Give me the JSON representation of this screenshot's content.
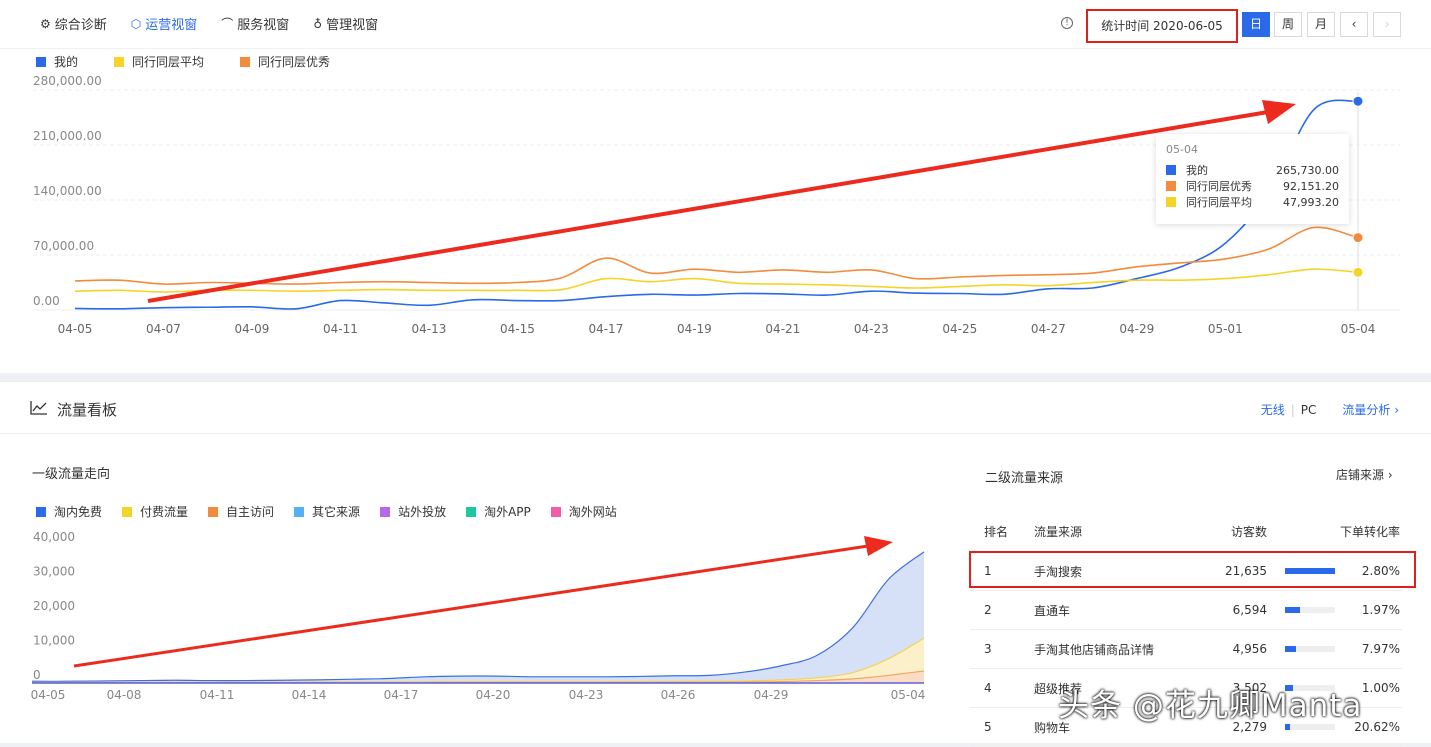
{
  "tabs": [
    {
      "label": "综合诊断",
      "icon": "diagnosis-icon",
      "active": false
    },
    {
      "label": "运营视窗",
      "icon": "operation-icon",
      "active": true
    },
    {
      "label": "服务视窗",
      "icon": "headset-icon",
      "active": false
    },
    {
      "label": "管理视窗",
      "icon": "management-icon",
      "active": false
    }
  ],
  "toolbar": {
    "stat_time": "统计时间 2020-06-05",
    "period_day": "日",
    "period_week": "周",
    "period_month": "月",
    "prev": "‹",
    "next": "›"
  },
  "top_chart": {
    "legend": [
      "我的",
      "同行同层平均",
      "同行同层优秀"
    ],
    "chart_data": {
      "type": "line",
      "x": [
        "04-05",
        "04-06",
        "04-07",
        "04-08",
        "04-09",
        "04-10",
        "04-11",
        "04-12",
        "04-13",
        "04-14",
        "04-15",
        "04-16",
        "04-17",
        "04-18",
        "04-19",
        "04-20",
        "04-21",
        "04-22",
        "04-23",
        "04-24",
        "04-25",
        "04-26",
        "04-27",
        "04-28",
        "04-29",
        "04-30",
        "05-01",
        "05-02",
        "05-03",
        "05-04"
      ],
      "x_tick_labels": [
        "04-05",
        "04-07",
        "04-09",
        "04-11",
        "04-13",
        "04-15",
        "04-17",
        "04-19",
        "04-21",
        "04-23",
        "04-25",
        "04-27",
        "04-29",
        "05-01",
        "05-04"
      ],
      "y_tick_labels": [
        "0.00",
        "70,000.00",
        "140,000.00",
        "210,000.00",
        "280,000.00"
      ],
      "ylim": [
        0,
        280000
      ],
      "series": [
        {
          "name": "我的",
          "color": "#2a6ae9",
          "values": [
            2000,
            1500,
            3000,
            3500,
            4000,
            1500,
            12000,
            9000,
            6000,
            13000,
            12000,
            12000,
            17000,
            20000,
            19000,
            21000,
            20500,
            19000,
            24000,
            21500,
            21000,
            20000,
            27000,
            28000,
            40000,
            55000,
            85000,
            150000,
            255000,
            265730
          ]
        },
        {
          "name": "同行同层平均",
          "color": "#f5d327",
          "values": [
            24000,
            25000,
            23000,
            25000,
            25000,
            24000,
            25000,
            26000,
            25000,
            25000,
            25000,
            26000,
            40000,
            36000,
            40000,
            34000,
            33000,
            32000,
            30000,
            28000,
            30000,
            32000,
            31000,
            35000,
            38000,
            38000,
            40000,
            45000,
            52000,
            47993.2
          ]
        },
        {
          "name": "同行同层优秀",
          "color": "#f38b3c",
          "values": [
            37000,
            38000,
            33000,
            35000,
            34000,
            33000,
            35000,
            36000,
            35000,
            34000,
            35000,
            41000,
            66000,
            47000,
            52000,
            48000,
            51000,
            48000,
            51000,
            40000,
            42000,
            44000,
            45000,
            47000,
            55000,
            60000,
            65000,
            78000,
            105000,
            92151.2
          ]
        }
      ]
    },
    "tooltip": {
      "date": "05-04",
      "rows": [
        {
          "name": "我的",
          "value": "265,730.00",
          "color": "#2a6ae9"
        },
        {
          "name": "同行同层优秀",
          "value": "92,151.20",
          "color": "#f38b3c"
        },
        {
          "name": "同行同层平均",
          "value": "47,993.20",
          "color": "#f5d327"
        }
      ]
    }
  },
  "traffic": {
    "title": "流量看板",
    "link_wireless": "无线",
    "link_pc": "PC",
    "link_analysis": "流量分析 ›",
    "trend_title": "一级流量走向",
    "source_title": "二级流量来源",
    "store_source_link": "店铺来源 ›",
    "legend": [
      {
        "name": "淘内免费",
        "color": "#2a6ae9"
      },
      {
        "name": "付费流量",
        "color": "#f5d327"
      },
      {
        "name": "自主访问",
        "color": "#f38b3c"
      },
      {
        "name": "其它来源",
        "color": "#53b2f5"
      },
      {
        "name": "站外投放",
        "color": "#b46ae6"
      },
      {
        "name": "淘外APP",
        "color": "#1ec7a2"
      },
      {
        "name": "淘外网站",
        "color": "#f25ca7"
      }
    ],
    "chart_data": {
      "type": "area",
      "x_tick_labels": [
        "04-05",
        "04-08",
        "04-11",
        "04-14",
        "04-17",
        "04-20",
        "04-23",
        "04-26",
        "04-29",
        "05-04"
      ],
      "y_tick_labels": [
        "0",
        "10,000",
        "20,000",
        "30,000",
        "40,000"
      ],
      "ylim": [
        0,
        40000
      ],
      "series": [
        {
          "name": "淘内免费",
          "values": [
            500,
            500,
            600,
            700,
            800,
            700,
            700,
            800,
            900,
            1100,
            1300,
            1800,
            2000,
            2000,
            1800,
            1800,
            1800,
            1900,
            2100,
            2200,
            3200,
            5000,
            8000,
            16000,
            30000,
            38000
          ]
        },
        {
          "name": "付费流量",
          "values": [
            200,
            200,
            200,
            200,
            250,
            250,
            250,
            250,
            300,
            300,
            300,
            350,
            400,
            400,
            400,
            400,
            400,
            450,
            450,
            500,
            600,
            900,
            1500,
            3000,
            7000,
            13000
          ]
        },
        {
          "name": "自主访问",
          "values": [
            100,
            100,
            100,
            100,
            120,
            120,
            120,
            120,
            120,
            130,
            130,
            150,
            160,
            160,
            160,
            160,
            160,
            170,
            180,
            200,
            250,
            400,
            700,
            1200,
            2200,
            3500
          ]
        }
      ]
    },
    "table": {
      "headers": [
        "排名",
        "流量来源",
        "访客数",
        "下单转化率"
      ],
      "rows": [
        {
          "rank": "1",
          "source": "手淘搜索",
          "visitors": "21,635",
          "bar": 1.0,
          "conversion": "2.80%"
        },
        {
          "rank": "2",
          "source": "直通车",
          "visitors": "6,594",
          "bar": 0.305,
          "conversion": "1.97%"
        },
        {
          "rank": "3",
          "source": "手淘其他店铺商品详情",
          "visitors": "4,956",
          "bar": 0.229,
          "conversion": "7.97%"
        },
        {
          "rank": "4",
          "source": "超级推荐",
          "visitors": "3,502",
          "bar": 0.162,
          "conversion": "1.00%"
        },
        {
          "rank": "5",
          "source": "购物车",
          "visitors": "2,279",
          "bar": 0.105,
          "conversion": "20.62%"
        }
      ]
    }
  },
  "watermark": "头条 @花九卿Manta"
}
